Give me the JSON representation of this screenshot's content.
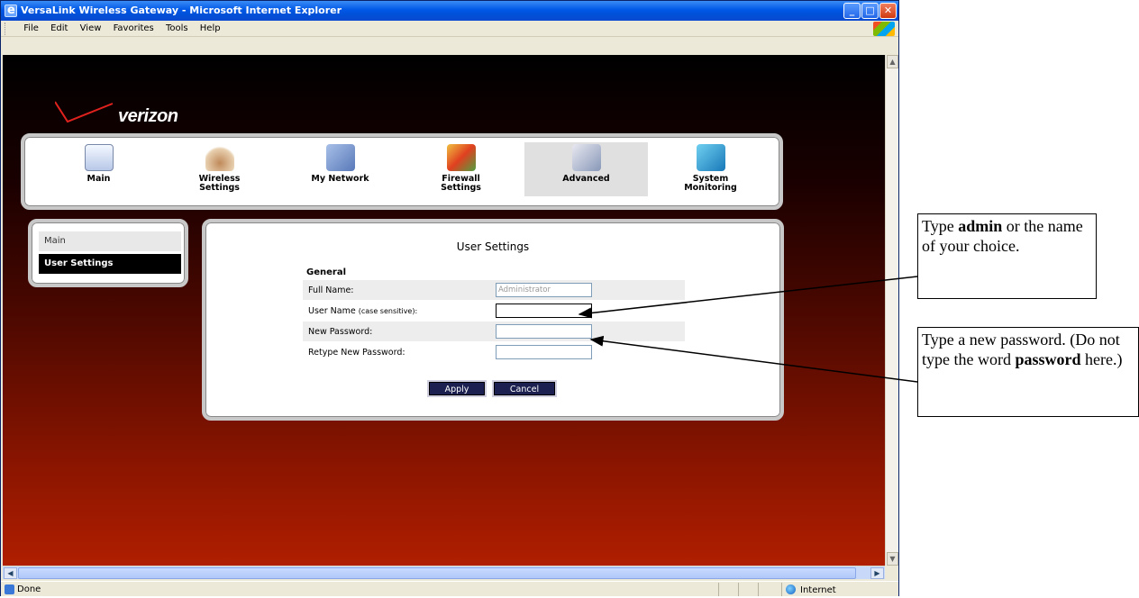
{
  "window": {
    "title": "VersaLink Wireless Gateway - Microsoft Internet Explorer",
    "menu": [
      "File",
      "Edit",
      "View",
      "Favorites",
      "Tools",
      "Help"
    ],
    "status_text": "Done",
    "zone": "Internet"
  },
  "brand": {
    "logo_text": "verizon"
  },
  "nav": [
    {
      "label": "Main",
      "icon": "main-icon"
    },
    {
      "label": "Wireless Settings",
      "icon": "wireless-icon"
    },
    {
      "label": "My Network",
      "icon": "network-icon"
    },
    {
      "label": "Firewall Settings",
      "icon": "firewall-icon"
    },
    {
      "label": "Advanced",
      "icon": "advanced-icon",
      "active": true
    },
    {
      "label": "System Monitoring",
      "icon": "monitor-icon"
    }
  ],
  "sidemenu": {
    "main": "Main",
    "user_settings": "User Settings"
  },
  "form": {
    "title": "User Settings",
    "section": "General",
    "full_name_label": "Full Name:",
    "full_name_value": "Administrator",
    "user_name_label": "User Name",
    "user_name_hint": "(case sensitive):",
    "new_password_label": "New Password:",
    "retype_label": "Retype New Password:",
    "apply": "Apply",
    "cancel": "Cancel"
  },
  "annotations": {
    "c1_pre": "Type ",
    "c1_bold": "admin",
    "c1_post": " or the name of your choice.",
    "c2_pre": "Type a new password. (Do not type the word ",
    "c2_bold": "password",
    "c2_post": " here.)"
  },
  "colors": {
    "nav_active": "#e0e0e0",
    "button": "#1b2050",
    "side_active": "#000000"
  }
}
